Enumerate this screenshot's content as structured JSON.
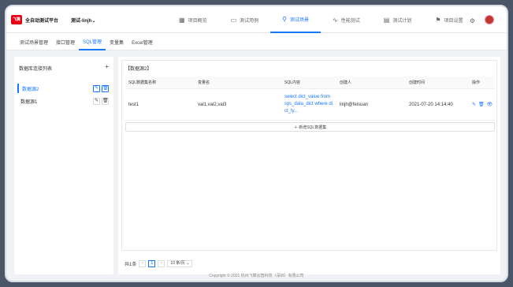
{
  "header": {
    "logo_text": "飞算",
    "app_title": "全自动测试平台",
    "project_name": "测试-linjh",
    "project_chevron": "⌄"
  },
  "nav": [
    {
      "label": "项目概览",
      "icon": "grid-icon",
      "glyph": "▦"
    },
    {
      "label": "测试用例",
      "icon": "folder-icon",
      "glyph": "▭"
    },
    {
      "label": "测试场景",
      "icon": "location-pin-icon",
      "glyph": "⚲"
    },
    {
      "label": "性能测试",
      "icon": "pulse-icon",
      "glyph": "∿"
    },
    {
      "label": "测试计划",
      "icon": "calendar-icon",
      "glyph": "▤"
    },
    {
      "label": "项目设置",
      "icon": "settings-group-icon",
      "glyph": "⚑"
    }
  ],
  "subtabs": [
    "测试场景管理",
    "接口管理",
    "SQL管理",
    "变量集",
    "Excel管理"
  ],
  "sidebar": {
    "title": "数据库连接列表",
    "add": "+",
    "items": [
      {
        "label": "数据源2"
      },
      {
        "label": "数据源1"
      }
    ]
  },
  "main": {
    "panel_title": "【数据源2】",
    "columns": [
      "SQL数据集名称",
      "变量名",
      "SQL内容",
      "创建人",
      "创建时间",
      "操作"
    ],
    "rows": [
      {
        "name": "test1",
        "vars": "val1,val2,val3",
        "sql_line1": "select dict_value from",
        "sql_line2": "sys_data_dict where di",
        "sql_line3": "ct_ty...",
        "creator": "linjh@feisuan",
        "created": "2021-07-20 14:14:40"
      }
    ],
    "add_label": "新增SQL数据集"
  },
  "pagination": {
    "total": "共1条",
    "prev": "‹",
    "page": "1",
    "next": "›",
    "page_size": "10 条/页 ⌄"
  },
  "footer": "Copyright © 2021 杭州飞算云智科技（深圳）有限公司"
}
